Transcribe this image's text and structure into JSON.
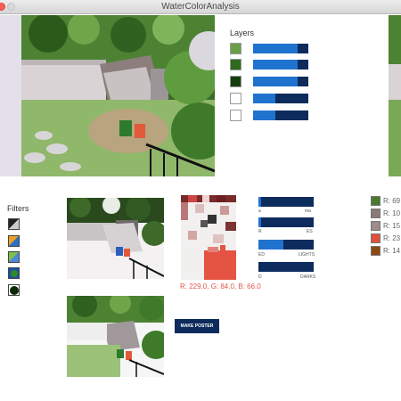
{
  "window": {
    "title": "WaterColorAnalysis"
  },
  "layers": {
    "label": "Layers",
    "items": [
      {
        "fill_percent": 80,
        "swatch": "#6b9e4a"
      },
      {
        "fill_percent": 80,
        "swatch": "#2f6a1e"
      },
      {
        "fill_percent": 80,
        "swatch": "#163d10"
      },
      {
        "fill_percent": 40,
        "swatch": "#ffffff"
      },
      {
        "fill_percent": 40,
        "swatch": "#ffffff"
      }
    ]
  },
  "filters": {
    "label": "Filters",
    "items": [
      {
        "icon": "gray-filter-icon"
      },
      {
        "icon": "orange-blue-filter-icon"
      },
      {
        "icon": "green-filter-icon"
      },
      {
        "icon": "blue-green-filter-icon"
      },
      {
        "icon": "dark-green-filter-icon"
      }
    ]
  },
  "pixel_inspector": {
    "rgb_readout": "R: 229.0, G: 84.0, B: 66.0",
    "color": "#e55442"
  },
  "tones": {
    "bars": [
      {
        "fill_percent": 5
      },
      {
        "fill_percent": 5
      },
      {
        "fill_percent": 45
      },
      {
        "fill_percent": 0
      }
    ],
    "labels": {
      "b1_left": "a",
      "b1_right": "ma",
      "b2_left": "R",
      "b2_right": "ES",
      "b3_left": "ED",
      "b3_right": "LIGHTS",
      "b4_left": "D",
      "b4_right": "DARKS"
    }
  },
  "palette": {
    "swatches": [
      {
        "color": "#4a7a2e",
        "text": "R: 69"
      },
      {
        "color": "#8a7a78",
        "text": "R: 10"
      },
      {
        "color": "#9e8b8a",
        "text": "R: 15"
      },
      {
        "color": "#e0503a",
        "text": "R: 23"
      },
      {
        "color": "#8a4a12",
        "text": "R: 14"
      }
    ]
  },
  "poster": {
    "button_label": "MAKE POSTER"
  }
}
